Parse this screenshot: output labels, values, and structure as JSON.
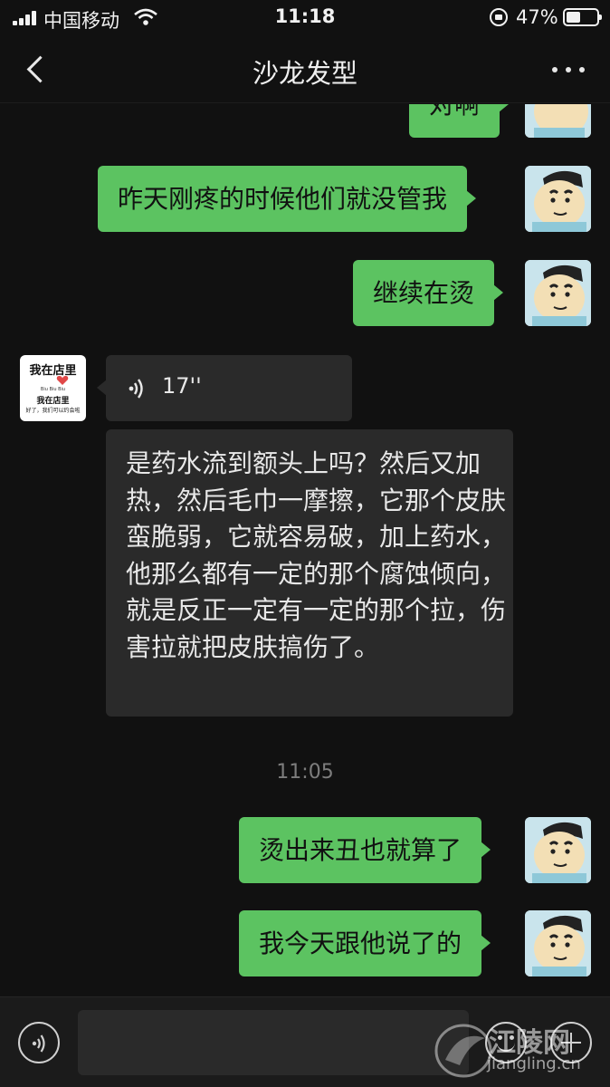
{
  "status_bar": {
    "carrier": "中国移动",
    "time": "11:18",
    "battery": "47%",
    "icons": [
      "signal-icon",
      "wifi-icon",
      "rotation-lock-icon",
      "battery-icon"
    ]
  },
  "nav": {
    "title": "沙龙发型",
    "back_icon": "chevron-left-icon",
    "more_icon": "more-horizontal-icon"
  },
  "messages": [
    {
      "side": "sent",
      "text": "对啊"
    },
    {
      "side": "sent",
      "text": "昨天刚疼的时候他们就没管我"
    },
    {
      "side": "sent",
      "text": "继续在烫"
    },
    {
      "side": "received",
      "type": "voice",
      "duration": "17''"
    },
    {
      "side": "received",
      "text": "是药水流到额头上吗？然后又加热，然后毛巾一摩擦，它那个皮肤蛮脆弱，它就容易破，加上药水，他那么都有一定的那个腐蚀倾向，就是反正一定有一定的那个拉，伤害拉就把皮肤搞伤了。"
    },
    {
      "side": "sent",
      "text": "烫出来丑也就算了"
    },
    {
      "side": "sent",
      "text": "我今天跟他说了的"
    }
  ],
  "timestamp": "11:05",
  "contact_avatar": {
    "title": "我在店里",
    "subtitle": "Biu Biu Biu",
    "line2": "我在店里",
    "line3": "好了，我们可以约会啦"
  },
  "input": {
    "value": "",
    "voice_icon": "voice-icon",
    "emoji_icon": "emoji-icon",
    "add_icon": "add-icon"
  },
  "watermark": {
    "name": "江陵网",
    "url": "jiangling.cn"
  },
  "colors": {
    "background": "#111111",
    "sent_bubble": "#5cc361",
    "received_bubble": "#2a2a2a"
  }
}
